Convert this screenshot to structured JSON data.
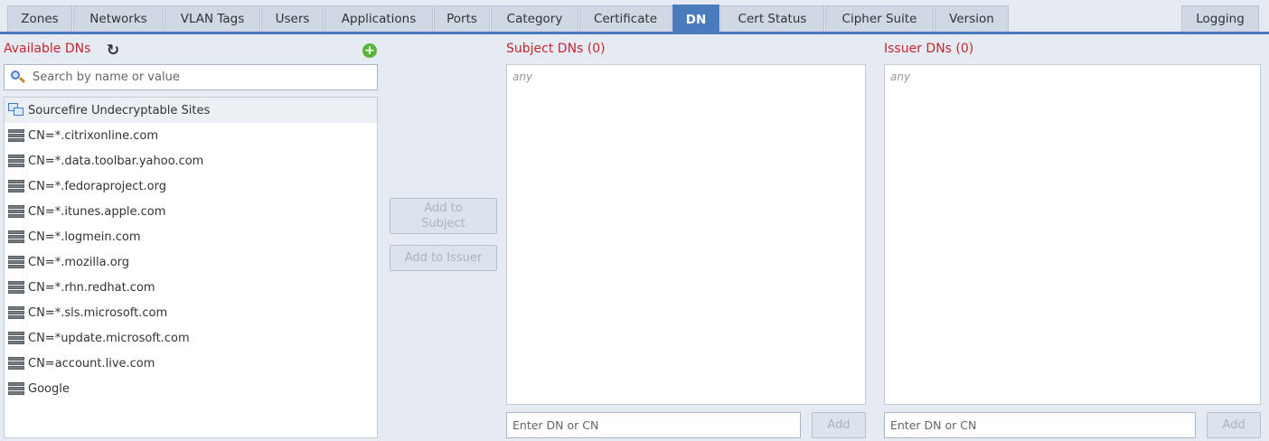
{
  "tabs": [
    {
      "label": "Zones"
    },
    {
      "label": "Networks"
    },
    {
      "label": "VLAN Tags"
    },
    {
      "label": "Users"
    },
    {
      "label": "Applications"
    },
    {
      "label": "Ports"
    },
    {
      "label": "Category"
    },
    {
      "label": "Certificate"
    },
    {
      "label": "DN",
      "active": true
    },
    {
      "label": "Cert Status"
    },
    {
      "label": "Cipher Suite"
    },
    {
      "label": "Version"
    },
    {
      "label": "Logging"
    }
  ],
  "available": {
    "title": "Available DNs",
    "refresh_icon": "refresh-icon",
    "add_icon": "add-circle-icon",
    "search_placeholder": "Search by name or value",
    "items": [
      {
        "label": "Sourcefire Undecryptable Sites",
        "icon": "group-icon"
      },
      {
        "label": "CN=*.citrixonline.com",
        "icon": "server-icon"
      },
      {
        "label": "CN=*.data.toolbar.yahoo.com",
        "icon": "server-icon"
      },
      {
        "label": "CN=*.fedoraproject.org",
        "icon": "server-icon"
      },
      {
        "label": "CN=*.itunes.apple.com",
        "icon": "server-icon"
      },
      {
        "label": "CN=*.logmein.com",
        "icon": "server-icon"
      },
      {
        "label": "CN=*.mozilla.org",
        "icon": "server-icon"
      },
      {
        "label": "CN=*.rhn.redhat.com",
        "icon": "server-icon"
      },
      {
        "label": "CN=*.sls.microsoft.com",
        "icon": "server-icon"
      },
      {
        "label": "CN=*update.microsoft.com",
        "icon": "server-icon"
      },
      {
        "label": "CN=account.live.com",
        "icon": "server-icon"
      },
      {
        "label": "Google",
        "icon": "server-icon"
      }
    ]
  },
  "actions": {
    "add_to_subject_line1": "Add to",
    "add_to_subject_line2": "Subject",
    "add_to_issuer": "Add to Issuer"
  },
  "subject": {
    "title": "Subject DNs (0)",
    "empty_text": "any",
    "input_placeholder": "Enter DN or CN",
    "add_label": "Add"
  },
  "issuer": {
    "title": "Issuer DNs (0)",
    "empty_text": "any",
    "input_placeholder": "Enter DN or CN",
    "add_label": "Add"
  },
  "colors": {
    "accent": "#4b7bbd",
    "title_red": "#c4272f",
    "add_green": "#58b43a"
  }
}
